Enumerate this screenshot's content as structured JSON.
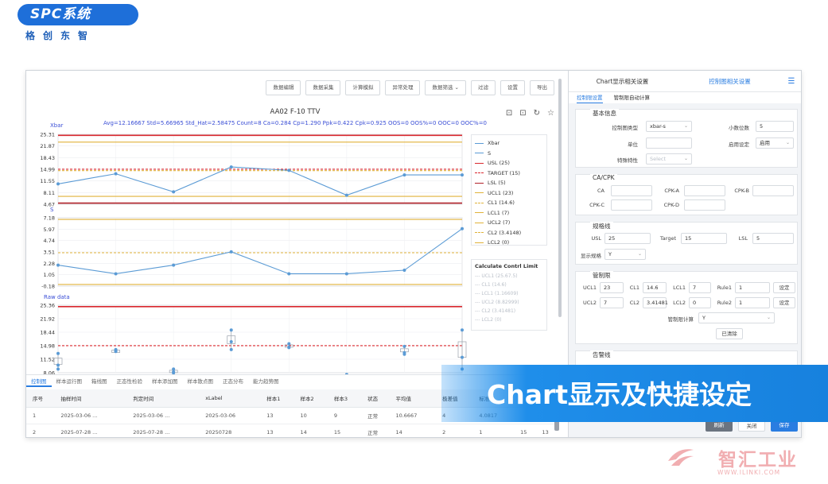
{
  "brand": {
    "logo": "SPC系统",
    "subtitle": "格创东智"
  },
  "toolbar": [
    "数据编辑",
    "数据采集",
    "计算模拟",
    "异常处理",
    "数据筛选",
    "过滤",
    "设置",
    "导出"
  ],
  "chart": {
    "title": "AA02 F-10 TTV",
    "stats": "Avg=12.16667 Std=5.66965 Std_Hat=2.58475 Count=8 Ca=0.284 Cp=1.290 Ppk=0.422 Cpk=0.925 OOS=0 OOS%=0 OOC=0 OOC%=0",
    "icons": [
      "zoom-in-icon",
      "zoom-out-icon",
      "refresh-icon",
      "star-icon"
    ]
  },
  "chart_data": [
    {
      "type": "line",
      "ylabel": "Xbar",
      "yticks": [
        "25.31",
        "21.87",
        "18.43",
        "14.99",
        "11.55",
        "8.11",
        "4.67"
      ],
      "ylim": [
        4.67,
        25.31
      ],
      "x": [
        1,
        2,
        3,
        4,
        5,
        6,
        7,
        8
      ],
      "series": [
        {
          "name": "Xbar",
          "values": [
            10.67,
            13.67,
            8.33,
            15.67,
            14.67,
            7.33,
            13.33,
            13.33
          ],
          "color": "#5b9bd5"
        }
      ],
      "lines": [
        {
          "name": "USL",
          "value": 25,
          "color": "#d9282e",
          "dash": false
        },
        {
          "name": "TARGET",
          "value": 15,
          "color": "#d9282e",
          "dash": true
        },
        {
          "name": "LSL",
          "value": 5,
          "color": "#b2222a",
          "dash": false
        },
        {
          "name": "UCL1",
          "value": 23,
          "color": "#e0b23a",
          "dash": false
        },
        {
          "name": "CL1",
          "value": 14.6,
          "color": "#e0b23a",
          "dash": true
        },
        {
          "name": "LCL1",
          "value": 7,
          "color": "#e0b23a",
          "dash": false
        }
      ]
    },
    {
      "type": "line",
      "ylabel": "S",
      "yticks": [
        "7.18",
        "5.97",
        "4.74",
        "3.51",
        "2.28",
        "1.05",
        "-0.18"
      ],
      "ylim": [
        -0.18,
        7.18
      ],
      "x": [
        1,
        2,
        3,
        4,
        5,
        6,
        7,
        8
      ],
      "series": [
        {
          "name": "S",
          "values": [
            2.08,
            1.15,
            2.08,
            3.51,
            1.15,
            1.15,
            1.53,
            6.0
          ],
          "color": "#5b9bd5"
        }
      ],
      "lines": [
        {
          "name": "UCL2",
          "value": 7,
          "color": "#e0b23a",
          "dash": false
        },
        {
          "name": "CL2",
          "value": 3.4148,
          "color": "#e0b23a",
          "dash": true
        },
        {
          "name": "LCL2",
          "value": 0,
          "color": "#e0b23a",
          "dash": false
        }
      ]
    },
    {
      "type": "scatter",
      "ylabel": "Raw data",
      "yticks": [
        "25.36",
        "21.92",
        "18.44",
        "14.98",
        "11.52",
        "8.06"
      ],
      "ylim": [
        8.06,
        25.36
      ],
      "points": [
        {
          "x": 1,
          "y": [
            13,
            10,
            9
          ]
        },
        {
          "x": 2,
          "y": [
            14,
            13.5,
            13.6
          ]
        },
        {
          "x": 3,
          "y": [
            9,
            8,
            8.3
          ]
        },
        {
          "x": 4,
          "y": [
            19,
            16,
            14
          ]
        },
        {
          "x": 5,
          "y": [
            15.5,
            14.5,
            14.6
          ]
        },
        {
          "x": 6,
          "y": [
            7.6,
            7.5,
            7.4
          ]
        },
        {
          "x": 7,
          "y": [
            14.8,
            13.2,
            12.8
          ]
        },
        {
          "x": 8,
          "y": [
            19,
            12,
            9
          ]
        }
      ],
      "lines": [
        {
          "name": "USL",
          "value": 25,
          "color": "#d9282e",
          "dash": false
        },
        {
          "name": "TARGET",
          "value": 15,
          "color": "#d9282e",
          "dash": true
        }
      ]
    }
  ],
  "legend": [
    {
      "label": "Xbar",
      "color": "#5b9bd5",
      "dash": false
    },
    {
      "label": "S",
      "color": "#5b9bd5",
      "dash": false
    },
    {
      "label": "USL  (25)",
      "color": "#d9282e",
      "dash": false
    },
    {
      "label": "TARGET  (15)",
      "color": "#d9282e",
      "dash": true
    },
    {
      "label": "LSL  (5)",
      "color": "#b2222a",
      "dash": false
    },
    {
      "label": "UCL1  (23)",
      "color": "#e0b23a",
      "dash": false
    },
    {
      "label": "CL1  (14.6)",
      "color": "#e0b23a",
      "dash": true
    },
    {
      "label": "LCL1  (7)",
      "color": "#e0b23a",
      "dash": false
    },
    {
      "label": "UCL2  (7)",
      "color": "#e0b23a",
      "dash": false
    },
    {
      "label": "CL2  (3.4148)",
      "color": "#e0b23a",
      "dash": true
    },
    {
      "label": "LCL2  (0)",
      "color": "#e0b23a",
      "dash": false
    }
  ],
  "calc_limit": {
    "title": "Calculate Contrl Limit",
    "items": [
      "--- UCL1  (25.67.5)",
      "--- CL1  (14.6)",
      "--- LCL1  (1.16609)",
      "--- UCL2  (8.82999)",
      "--- CL2  (3.41481)",
      "--- LCL2  (0)"
    ]
  },
  "tabs": [
    "控制图",
    "样本运行图",
    "箱线图",
    "正态性检验",
    "样本添加图",
    "样本散点图",
    "正态分布",
    "能力趋势图"
  ],
  "table": {
    "headers": [
      "序号",
      "抽样时间",
      "判定时间",
      "xLabel",
      "样本1",
      "样本2",
      "样本3",
      "状态",
      "平均值",
      "极差值",
      "标准差",
      "",
      ""
    ],
    "rows": [
      [
        "1",
        "2025-03-06 ...",
        "2025-03-06 ...",
        "2025-03-06",
        "13",
        "10",
        "9",
        "正常",
        "10.6667",
        "4",
        "4.0817",
        "",
        ""
      ],
      [
        "2",
        "2025-07-28 ...",
        "2025-07-28 ...",
        "20250728",
        "13",
        "14",
        "15",
        "正常",
        "14",
        "2",
        "1",
        "15",
        "13"
      ]
    ]
  },
  "panel": {
    "tabs": [
      "Chart显示相关设置",
      "控制图相关设置"
    ],
    "subtabs": [
      "控制限设置",
      "管制限自动计算"
    ],
    "basic": {
      "title": "基本信息",
      "chart_type_label": "控制图类型",
      "chart_type": "xbar-s",
      "decimals_label": "小数位数",
      "decimals": "5",
      "unit_label": "单位",
      "enable_label": "启用设定",
      "enable": "启用",
      "special_label": "特殊特性",
      "special": "Select"
    },
    "cacpk": {
      "title": "CA/CPK",
      "labels": [
        "CA",
        "CPK-A",
        "CPK-B",
        "CPK-C",
        "CPK-D"
      ]
    },
    "spec": {
      "title": "规格线",
      "usl_label": "USL",
      "usl": "25",
      "target_label": "Target",
      "target": "15",
      "lsl_label": "LSL",
      "lsl": "5",
      "show_label": "显示规格",
      "show": "Y"
    },
    "control": {
      "title": "管制限",
      "ucl1_label": "UCL1",
      "ucl1": "23",
      "cl1_label": "CL1",
      "cl1": "14.6",
      "lcl1_label": "LCL1",
      "lcl1": "7",
      "rule1_label": "Rule1",
      "rule1": "1",
      "ucl2_label": "UCL2",
      "ucl2": "7",
      "cl2_label": "CL2",
      "cl2": "3.41481",
      "lcl2_label": "LCL2",
      "lcl2": "0",
      "rule2_label": "Rule2",
      "rule2": "1",
      "set_label": "设定",
      "auto_label": "管制限计算",
      "auto": "Y",
      "clear_label": "已清除"
    },
    "alarm": {
      "title": "告警线"
    },
    "footer": {
      "refresh": "刷新",
      "close": "关闭",
      "save": "保存"
    }
  },
  "banner": {
    "text": "Chart显示及快捷设定"
  },
  "watermark": {
    "name": "智汇工业",
    "url": "WWW.ILINKI.COM"
  }
}
